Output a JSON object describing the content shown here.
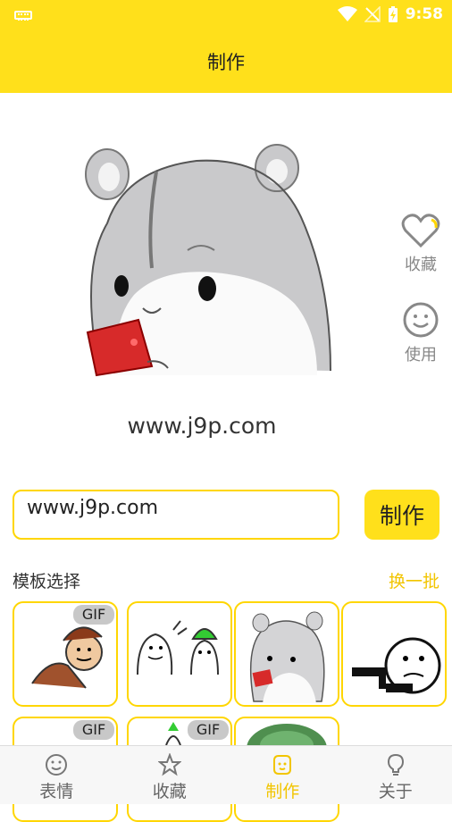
{
  "status": {
    "time": "9:58"
  },
  "header": {
    "title": "制作"
  },
  "preview": {
    "caption": "www.j9p.com"
  },
  "side": {
    "favorite_label": "收藏",
    "use_label": "使用"
  },
  "editor": {
    "input_value": "www.j9p.com",
    "make_label": "制作"
  },
  "templates": {
    "section_label": "模板选择",
    "refresh_label": "换一批",
    "gif_badge": "GIF"
  },
  "tabs": [
    {
      "label": "表情",
      "icon": "smile-icon"
    },
    {
      "label": "收藏",
      "icon": "star-icon"
    },
    {
      "label": "制作",
      "icon": "make-icon"
    },
    {
      "label": "关于",
      "icon": "bulb-icon"
    }
  ],
  "colors": {
    "accent": "#ffe01b",
    "accent_text": "#f2c500"
  }
}
